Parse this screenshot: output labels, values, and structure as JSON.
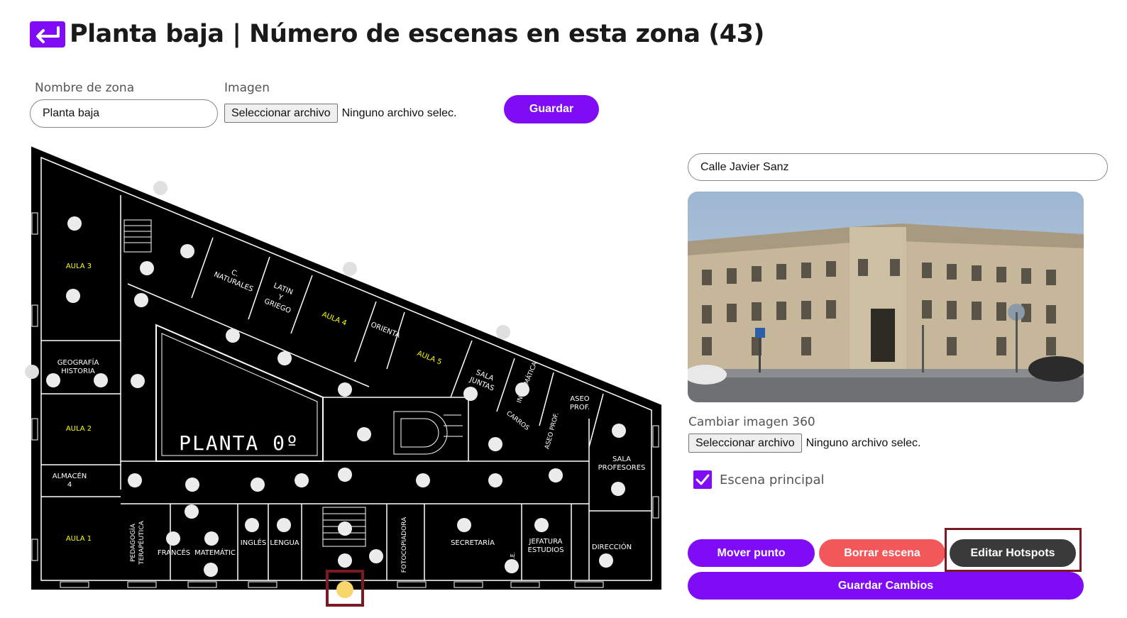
{
  "header": {
    "back_icon": "return-arrow-icon",
    "title": "Planta baja | Número de escenas en esta zona (43)"
  },
  "zone_form": {
    "name_label": "Nombre de zona",
    "name_value": "Planta baja",
    "image_label": "Imagen",
    "file_button": "Seleccionar archivo",
    "file_status": "Ninguno archivo selec.",
    "save_button": "Guardar"
  },
  "floor_plan": {
    "rooms": {
      "aula3": "AULA 3",
      "naturales1": "C.",
      "naturales2": "NATURALES",
      "latin1": "LATIN",
      "latin2": "Y",
      "latin3": "GRIEGO",
      "aula4": "AULA 4",
      "orienta": "ORIENTA",
      "aula5": "AULA 5",
      "sala_juntas1": "SALA",
      "sala_juntas2": "JUNTAS",
      "informatica": "INFORMÁTICA",
      "aseo_prof1": "ASEO",
      "aseo_prof2": "PROF.",
      "carros": "CARROS",
      "aseo_prof_v": "ASEO PROF.",
      "geografia1": "GEOGRAFÍA",
      "geografia2": "HISTORIA",
      "aula2": "AULA 2",
      "planta": "PLANTA 0º",
      "sala_prof1": "SALA",
      "sala_prof2": "PROFESORES",
      "almacen1": "ALMACÉN",
      "almacen2": "4",
      "aula1": "AULA 1",
      "pedagogia1": "PEDAGOGÍA",
      "pedagogia2": "TERAPÉUTICA",
      "frances": "FRANCÉS",
      "matematic": "MATEMÁTIC",
      "ingles": "INGLÉS",
      "lengua": "LENGUA",
      "fotocopiadora": "FOTOCOPIADORA",
      "secretaria": "SECRETARÍA",
      "servicio": "S.M.E.",
      "jefatura1": "JEFATURA",
      "jefatura2": "ESTUDIOS",
      "direccion": "DIRECCIÓN"
    },
    "hotspot_count_shown": 43
  },
  "scene_panel": {
    "scene_name": "Calle Javier Sanz",
    "change_image_label": "Cambiar imagen 360",
    "file_button": "Seleccionar archivo",
    "file_status": "Ninguno archivo selec.",
    "main_scene_label": "Escena principal",
    "main_scene_checked": true,
    "move_button": "Mover punto",
    "delete_button": "Borrar escena",
    "hotspots_button": "Editar Hotspots",
    "save_changes_button": "Guardar Cambios"
  },
  "colors": {
    "accent": "#7f0cf5",
    "danger": "#f2575a",
    "dark_button": "#3a3a3a",
    "plan_background": "#000000",
    "plan_labels": "#ffff00",
    "selected_hotspot": "#f7d76b",
    "highlight_frame": "#7a1a24"
  }
}
